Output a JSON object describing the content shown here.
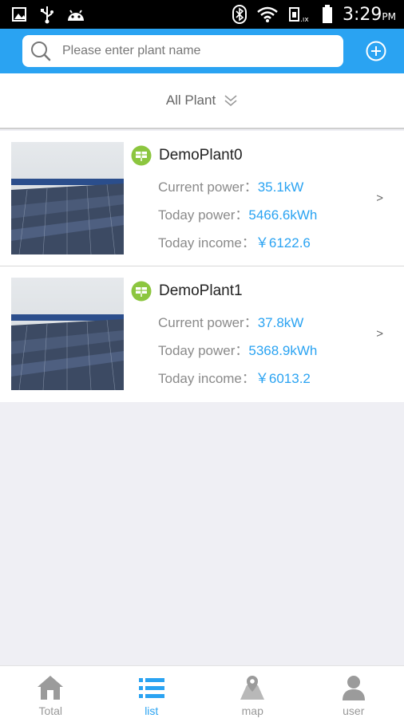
{
  "status_bar": {
    "time": "3:29",
    "ampm": "PM"
  },
  "search": {
    "placeholder": "Please enter plant name"
  },
  "filter": {
    "label": "All Plant"
  },
  "plants": [
    {
      "name": "DemoPlant0",
      "current_power_label": "Current power：",
      "current_power": "35.1kW",
      "today_power_label": "Today power：",
      "today_power": "5466.6kWh",
      "today_income_label": "Today income：",
      "today_income": "￥6122.6",
      "arrow": ">"
    },
    {
      "name": "DemoPlant1",
      "current_power_label": "Current power：",
      "current_power": "37.8kW",
      "today_power_label": "Today power：",
      "today_power": "5368.9kWh",
      "today_income_label": "Today income：",
      "today_income": "￥6013.2",
      "arrow": ">"
    }
  ],
  "tabs": [
    {
      "label": "Total",
      "icon": "house-icon",
      "active": false
    },
    {
      "label": "list",
      "icon": "list-icon",
      "active": true
    },
    {
      "label": "map",
      "icon": "map-icon",
      "active": false
    },
    {
      "label": "user",
      "icon": "user-icon",
      "active": false
    }
  ],
  "colors": {
    "accent": "#2aa3f2",
    "plant_icon": "#8cc63f",
    "tab_inactive": "#9b9b9b"
  }
}
